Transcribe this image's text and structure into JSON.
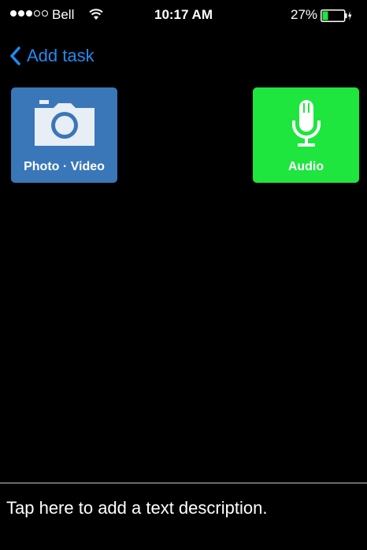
{
  "status_bar": {
    "signal_filled": 3,
    "signal_total": 5,
    "carrier": "Bell",
    "time": "10:17 AM",
    "battery_percent": "27%",
    "battery_level": 0.27
  },
  "nav": {
    "back_label": "Add task"
  },
  "tiles": {
    "photo_label": "Photo · Video",
    "audio_label": "Audio"
  },
  "description": {
    "placeholder": "Tap here to add a text description."
  },
  "colors": {
    "accent": "#1f8bf0",
    "photo_tile": "#3977b8",
    "audio_tile": "#1fe53f",
    "battery_fill": "#1fe53f",
    "background": "#000000"
  }
}
